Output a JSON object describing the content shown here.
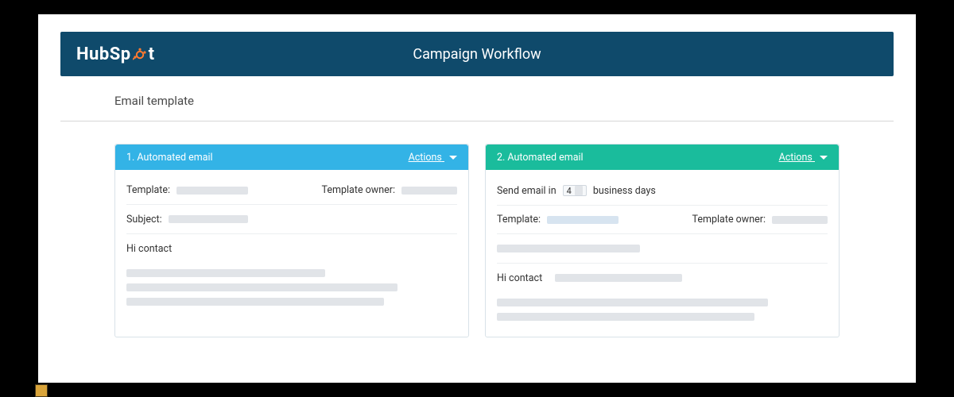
{
  "header": {
    "logo_text_pre": "HubSp",
    "logo_text_post": "t",
    "page_title": "Campaign Workflow"
  },
  "section": {
    "title": "Email template"
  },
  "cards": [
    {
      "header_title": "1. Automated email",
      "actions_label": "Actions",
      "template_label": "Template:",
      "template_owner_label": "Template owner:",
      "subject_label": "Subject:",
      "greeting": "Hi contact"
    },
    {
      "header_title": "2. Automated email",
      "actions_label": "Actions",
      "send_prefix": "Send email in",
      "send_value": "4",
      "send_suffix": "business days",
      "template_label": "Template:",
      "template_owner_label": "Template owner:",
      "greeting": "Hi contact"
    }
  ]
}
